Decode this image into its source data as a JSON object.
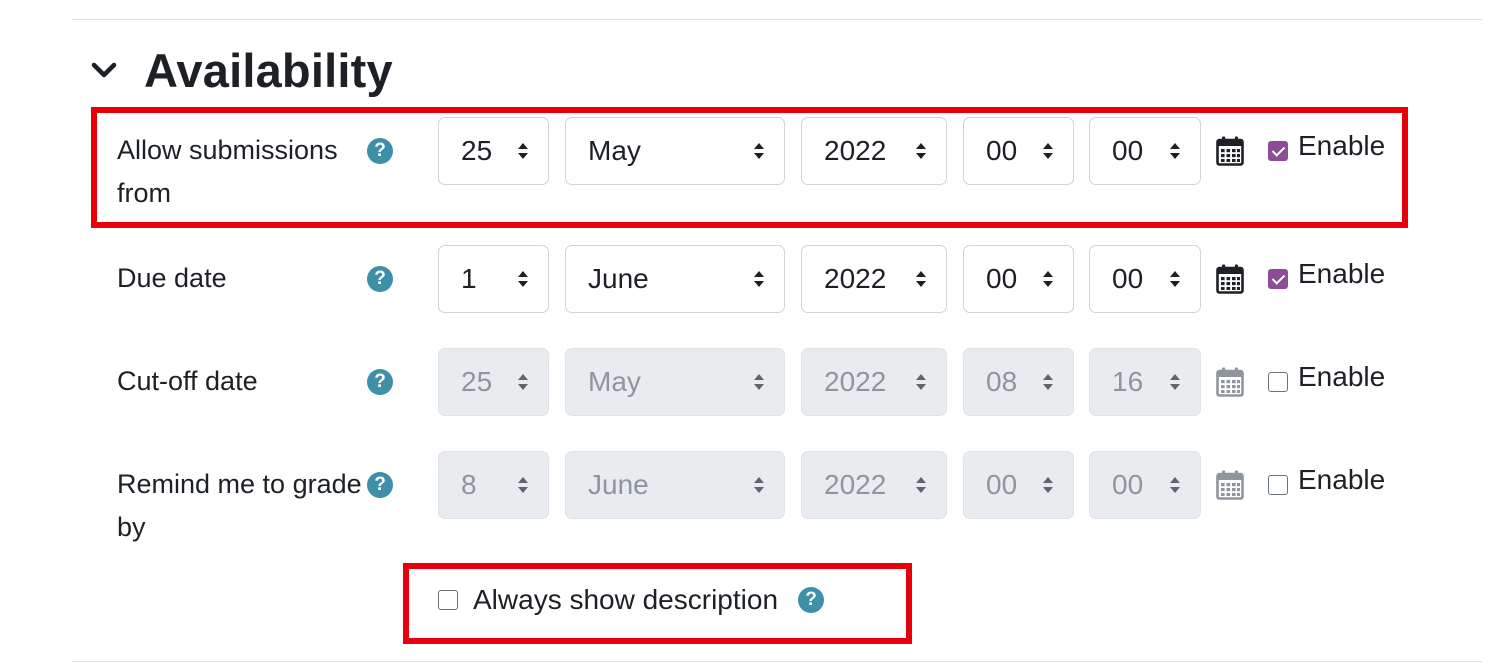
{
  "section": {
    "title": "Availability"
  },
  "fields": [
    {
      "label": "Allow submissions from",
      "day": "25",
      "month": "May",
      "year": "2022",
      "hour": "00",
      "minute": "00",
      "enable_label": "Enable",
      "enabled": true
    },
    {
      "label": "Due date",
      "day": "1",
      "month": "June",
      "year": "2022",
      "hour": "00",
      "minute": "00",
      "enable_label": "Enable",
      "enabled": true
    },
    {
      "label": "Cut-off date",
      "day": "25",
      "month": "May",
      "year": "2022",
      "hour": "08",
      "minute": "16",
      "enable_label": "Enable",
      "enabled": false
    },
    {
      "label": "Remind me to grade by",
      "day": "8",
      "month": "June",
      "year": "2022",
      "hour": "00",
      "minute": "00",
      "enable_label": "Enable",
      "enabled": false
    }
  ],
  "always_show": {
    "label": "Always show description",
    "checked": false
  },
  "help_glyph": "?",
  "icons": {
    "collapse": "chevron-down-icon",
    "help": "help-icon",
    "calendar": "calendar-icon",
    "caret": "select-caret-icon"
  },
  "colors": {
    "accent_checkbox": "#8a4d96",
    "help_icon": "#3e8fa8",
    "highlight_box": "#e8000b",
    "disabled_field_bg": "#e9ecef"
  }
}
